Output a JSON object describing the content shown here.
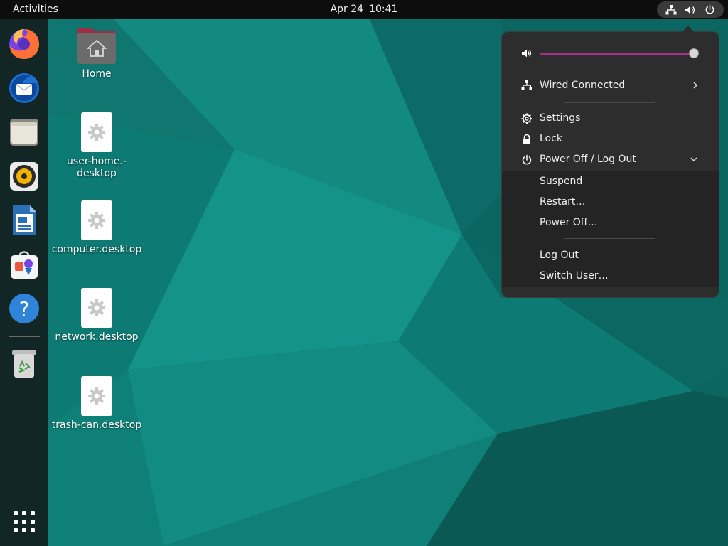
{
  "topbar": {
    "activities": "Activities",
    "date": "Apr 24",
    "time": "10:41",
    "status_icons": [
      "network-wired-icon",
      "volume-icon",
      "power-icon"
    ]
  },
  "dock": {
    "items": [
      {
        "name": "firefox-icon"
      },
      {
        "name": "thunderbird-icon"
      },
      {
        "name": "files-icon"
      },
      {
        "name": "rhythmbox-icon"
      },
      {
        "name": "libreoffice-writer-icon"
      },
      {
        "name": "software-store-icon"
      },
      {
        "name": "help-icon"
      },
      {
        "name": "trash-icon"
      },
      {
        "name": "show-apps-icon"
      }
    ]
  },
  "desktop": {
    "icons": [
      {
        "label": "Home",
        "icon": "home-folder-icon"
      },
      {
        "label": "user-home.-desktop",
        "label_line1": "user-home.-",
        "label_line2": "desktop",
        "icon": "desktop-file-gear-icon"
      },
      {
        "label": "computer.desktop",
        "icon": "desktop-file-gear-icon"
      },
      {
        "label": "network.desktop",
        "icon": "desktop-file-gear-icon"
      },
      {
        "label": "trash-can.desktop",
        "icon": "desktop-file-gear-icon"
      }
    ]
  },
  "menu": {
    "volume": {
      "level": 1.0,
      "icon": "volume-icon"
    },
    "network": {
      "label": "Wired Connected",
      "icon": "network-wired-icon"
    },
    "settings": {
      "label": "Settings",
      "icon": "gear-icon"
    },
    "lock": {
      "label": "Lock",
      "icon": "lock-icon"
    },
    "power": {
      "label": "Power Off / Log Out",
      "icon": "power-icon",
      "expanded": true
    },
    "power_submenu": {
      "suspend": "Suspend",
      "restart": "Restart…",
      "power_off": "Power Off…",
      "log_out": "Log Out",
      "switch_user": "Switch User…"
    }
  },
  "colors": {
    "wallpaper_base": "#0e6f6a",
    "accent": "#a3308e",
    "topbar_bg": "#0d0d0d",
    "menu_bg": "#2d2d2d"
  }
}
